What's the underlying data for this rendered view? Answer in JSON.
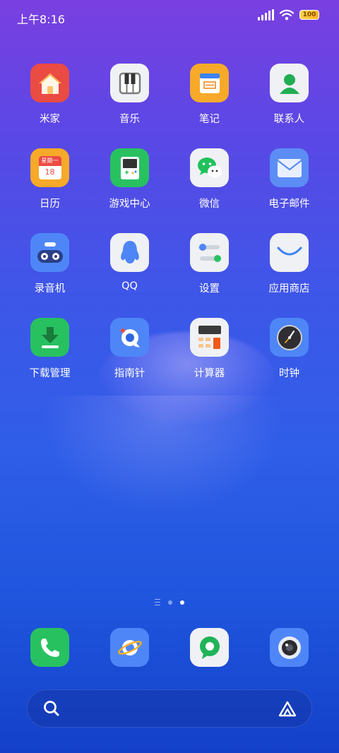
{
  "status": {
    "time": "上午8:16",
    "battery_level": "100"
  },
  "apps": [
    {
      "label": "米家",
      "icon": "house-icon",
      "bg": "#ea4b43"
    },
    {
      "label": "音乐",
      "icon": "piano-icon",
      "bg": "#f0f1f4"
    },
    {
      "label": "笔记",
      "icon": "notepad-icon",
      "bg": "#f7a92a"
    },
    {
      "label": "联系人",
      "icon": "contact-person-icon",
      "bg": "#f0f1f4"
    },
    {
      "label": "日历",
      "icon": "calendar-icon",
      "bg": "#f7a92a",
      "cal_day": "星期一",
      "cal_date": "18"
    },
    {
      "label": "游戏中心",
      "icon": "gameboy-icon",
      "bg": "#28c160"
    },
    {
      "label": "微信",
      "icon": "wechat-icon",
      "bg": "#f0f1f4"
    },
    {
      "label": "电子邮件",
      "icon": "mail-envelope-icon",
      "bg": "#5b8df5"
    },
    {
      "label": "录音机",
      "icon": "recorder-robot-icon",
      "bg": "#4f86f7"
    },
    {
      "label": "QQ",
      "icon": "qq-penguin-icon",
      "bg": "#f0f1f4"
    },
    {
      "label": "设置",
      "icon": "settings-toggles-icon",
      "bg": "#f0f1f4"
    },
    {
      "label": "应用商店",
      "icon": "app-store-bag-icon",
      "bg": "#f0f1f4"
    },
    {
      "label": "下载管理",
      "icon": "download-arrow-icon",
      "bg": "#28c160"
    },
    {
      "label": "指南针",
      "icon": "compass-icon",
      "bg": "#4f86f7"
    },
    {
      "label": "计算器",
      "icon": "calculator-icon",
      "bg": "#f0f1f4"
    },
    {
      "label": "时钟",
      "icon": "clock-icon",
      "bg": "#4f86f7"
    }
  ],
  "dock": [
    {
      "icon": "phone-icon",
      "bg": "#28c160"
    },
    {
      "icon": "browser-planet-icon",
      "bg": "#4f86f7"
    },
    {
      "icon": "message-bubble-icon",
      "bg": "#f0f1f4"
    },
    {
      "icon": "camera-icon",
      "bg": "#4f86f7"
    }
  ],
  "page_indicator": {
    "pages": 2,
    "active": 2
  }
}
